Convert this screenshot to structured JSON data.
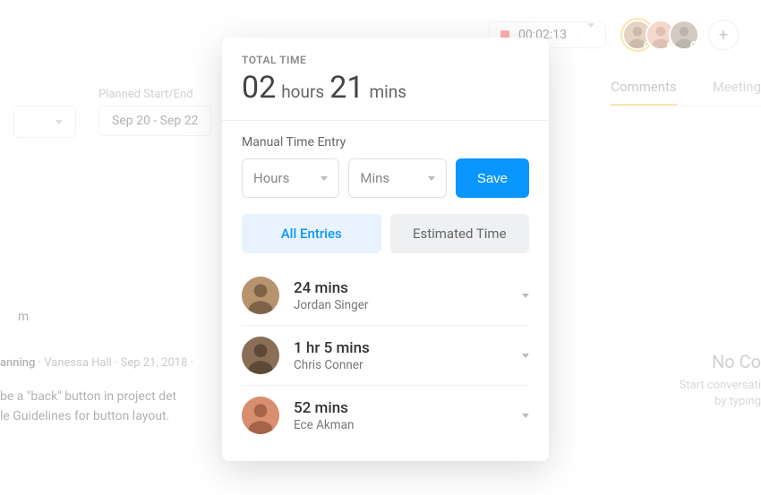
{
  "header": {
    "timer": "00:02:13"
  },
  "planned": {
    "label": "Planned Start/End",
    "range": "Sep 20 - Sep 22"
  },
  "tabs": {
    "comments": "Comments",
    "meeting": "Meeting"
  },
  "crumb": {
    "tag": "anning",
    "author": "Vanessa Hall",
    "date": "Sep 21, 2018"
  },
  "trunc_m": "m",
  "description": {
    "line1": "be a \"back\" button in project det",
    "line2": "le Guidelines for button layout."
  },
  "empty": {
    "title": "No Co",
    "sub1": "Start conversati",
    "sub2": "by typing"
  },
  "popover": {
    "total_label": "TOTAL TIME",
    "hours_num": "02",
    "hours_unit": "hours",
    "mins_num": "21",
    "mins_unit": "mins",
    "manual_label": "Manual Time Entry",
    "hours_ph": "Hours",
    "mins_ph": "Mins",
    "save": "Save",
    "tab_all": "All Entries",
    "tab_est": "Estimated Time",
    "entries": [
      {
        "time": "24 mins",
        "name": "Jordan Singer"
      },
      {
        "time": "1 hr 5 mins",
        "name": "Chris Conner"
      },
      {
        "time": "52 mins",
        "name": "Ece Akman"
      }
    ]
  },
  "avatar_svgs": {
    "male1": "#C9A07A",
    "female": "#E8A98D",
    "male2": "#A38C78",
    "entry0": "#B8946E",
    "entry1": "#8A6E55",
    "entry2": "#D98E6F"
  }
}
